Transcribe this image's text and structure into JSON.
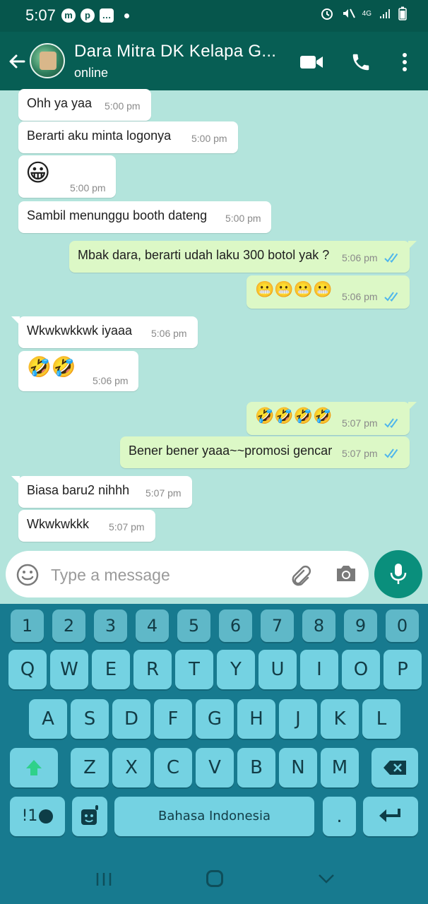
{
  "status_bar": {
    "time": "5:07",
    "network": "4G",
    "app_icons": [
      "messenger-icon",
      "pinterest-icon",
      "message-icon"
    ]
  },
  "header": {
    "contact_name": "Dara Mitra DK Kelapa G...",
    "status": "online"
  },
  "messages": [
    {
      "dir": "in",
      "text": "Ohh ya yaa",
      "time": "5:00 pm"
    },
    {
      "dir": "in",
      "text": "Berarti aku minta logonya",
      "time": "5:00 pm"
    },
    {
      "dir": "in",
      "text": "😀",
      "time": "5:00 pm"
    },
    {
      "dir": "in",
      "text": "Sambil menunggu booth dateng",
      "time": "5:00 pm"
    },
    {
      "dir": "out",
      "text": "Mbak dara, berarti udah laku 300 botol yak ?",
      "time": "5:06 pm"
    },
    {
      "dir": "out",
      "text": "😬😬😬😬",
      "time": "5:06 pm"
    },
    {
      "dir": "in",
      "text": "Wkwkwkkwk iyaaa",
      "time": "5:06 pm"
    },
    {
      "dir": "in",
      "text": "🤣🤣",
      "time": "5:06 pm"
    },
    {
      "dir": "out",
      "text": "🤣🤣🤣🤣",
      "time": "5:07 pm"
    },
    {
      "dir": "out",
      "text": "Bener bener yaaa~~promosi gencar",
      "time": "5:07 pm"
    },
    {
      "dir": "in",
      "text": "Biasa baru2 nihhh",
      "time": "5:07 pm"
    },
    {
      "dir": "in",
      "text": "Wkwkwkkk",
      "time": "5:07 pm"
    }
  ],
  "input": {
    "placeholder": "Type a message"
  },
  "keyboard": {
    "numbers": [
      "1",
      "2",
      "3",
      "4",
      "5",
      "6",
      "7",
      "8",
      "9",
      "0"
    ],
    "row1": [
      "Q",
      "W",
      "E",
      "R",
      "T",
      "Y",
      "U",
      "I",
      "O",
      "P"
    ],
    "row2": [
      "A",
      "S",
      "D",
      "F",
      "G",
      "H",
      "J",
      "K",
      "L"
    ],
    "row3": [
      "Z",
      "X",
      "C",
      "V",
      "B",
      "N",
      "M"
    ],
    "sym_label": "!1",
    "space_label": "Bahasa Indonesia",
    "period_label": "."
  },
  "colors": {
    "header": "#075e54",
    "chat_bg": "#b3e4dc",
    "incoming": "#ffffff",
    "outgoing": "#dcf8c6",
    "read_ticks": "#4fb6ec",
    "keyboard_bg": "#177a8f"
  }
}
